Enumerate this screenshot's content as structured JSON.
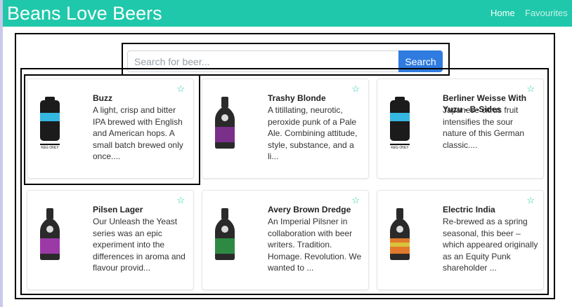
{
  "navbar": {
    "brand": "Beans Love Beers",
    "links": [
      "Home",
      "Favourites"
    ]
  },
  "search": {
    "placeholder": "Search for beer...",
    "button_label": "Search"
  },
  "colors": {
    "navbar": "#1fc8aa",
    "button": "#2f7be0",
    "star": "#1fc8aa"
  },
  "beers": [
    {
      "name": "Buzz",
      "description": "A light, crisp and bitter IPA brewed with English and American hops. A small batch brewed only once....",
      "image": "keg-icon",
      "favourite": false
    },
    {
      "name": "Trashy Blonde",
      "description": "A titillating, neurotic, peroxide punk of a Pale Ale. Combining attitude, style, substance, and a li...",
      "image": "bottle-icon",
      "favourite": false
    },
    {
      "name": "Berliner Weisse With Yuzu - B-Sides",
      "description": "Japanese citrus fruit intensifies the sour nature of this German classic....",
      "image": "keg-icon",
      "favourite": false
    },
    {
      "name": "Pilsen Lager",
      "description": "Our Unleash the Yeast series was an epic experiment into the differences in aroma and flavour provid...",
      "image": "bottle-icon",
      "favourite": false
    },
    {
      "name": "Avery Brown Dredge",
      "description": "An Imperial Pilsner in collaboration with beer writers. Tradition. Homage. Revolution. We wanted to ...",
      "image": "bottle-icon",
      "favourite": false
    },
    {
      "name": "Electric India",
      "description": "Re-brewed as a spring seasonal, this beer – which appeared originally as an Equity Punk shareholder ...",
      "image": "bottle-icon",
      "favourite": false
    }
  ]
}
